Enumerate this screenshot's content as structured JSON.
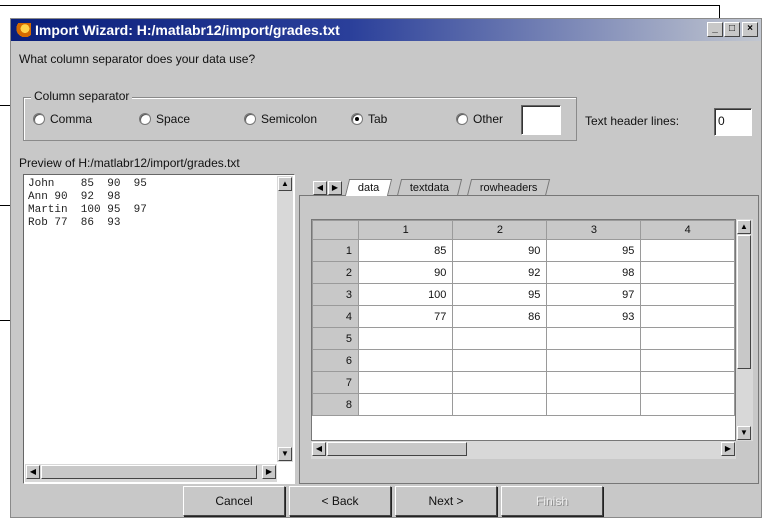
{
  "window": {
    "title": "Import Wizard: H:/matlabr12/import/grades.txt",
    "controls": [
      "_",
      "□",
      "×"
    ]
  },
  "prompt": "What column separator does your data use?",
  "separator_group": {
    "title": "Column separator",
    "options": [
      "Comma",
      "Space",
      "Semicolon",
      "Tab",
      "Other"
    ],
    "selected": "Tab",
    "other_value": ""
  },
  "header_lines": {
    "label": "Text header lines:",
    "value": "0"
  },
  "preview": {
    "label": "Preview of H:/matlabr12/import/grades.txt",
    "lines": [
      "John    85  90  95",
      "Ann 90  92  98",
      "Martin  100 95  97",
      "Rob 77  86  93"
    ]
  },
  "tabs": {
    "items": [
      "data",
      "textdata",
      "rowheaders"
    ],
    "active": "data"
  },
  "grid": {
    "columns": [
      "1",
      "2",
      "3",
      "4"
    ],
    "rows": [
      {
        "label": "1",
        "cells": [
          "85",
          "90",
          "95",
          ""
        ]
      },
      {
        "label": "2",
        "cells": [
          "90",
          "92",
          "98",
          ""
        ]
      },
      {
        "label": "3",
        "cells": [
          "100",
          "95",
          "97",
          ""
        ]
      },
      {
        "label": "4",
        "cells": [
          "77",
          "86",
          "93",
          ""
        ]
      },
      {
        "label": "5",
        "cells": [
          "",
          "",
          "",
          ""
        ]
      },
      {
        "label": "6",
        "cells": [
          "",
          "",
          "",
          ""
        ]
      },
      {
        "label": "7",
        "cells": [
          "",
          "",
          "",
          ""
        ]
      },
      {
        "label": "8",
        "cells": [
          "",
          "",
          "",
          ""
        ]
      }
    ]
  },
  "buttons": {
    "cancel": "Cancel",
    "back": "< Back",
    "next": "Next >",
    "finish": "Finish"
  }
}
